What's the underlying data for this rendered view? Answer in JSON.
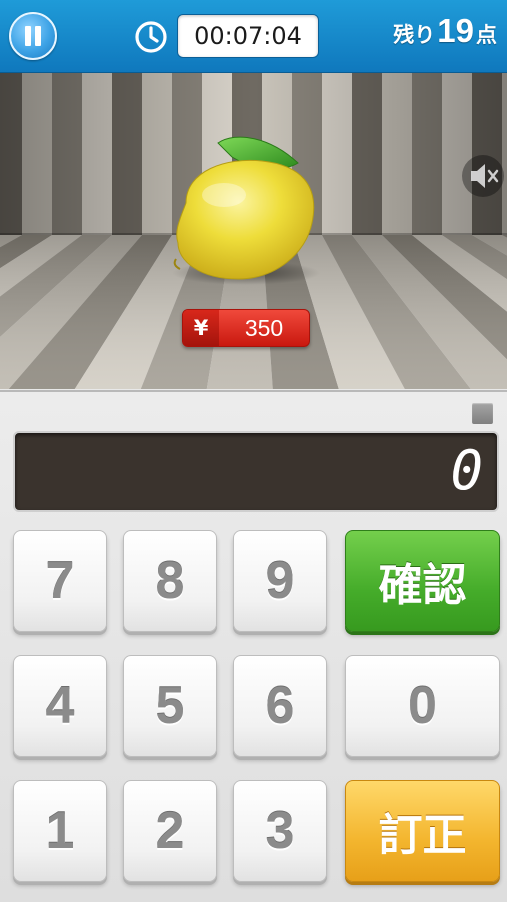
{
  "header": {
    "timer": "00:07:04",
    "remaining_prefix": "残り",
    "remaining_count": "19",
    "remaining_suffix": "点"
  },
  "stage": {
    "item": "lemon-image",
    "price_currency": "¥",
    "price_value": "350"
  },
  "calculator": {
    "display_value": "0",
    "keys": {
      "k7": "7",
      "k8": "8",
      "k9": "9",
      "k4": "4",
      "k5": "5",
      "k6": "6",
      "k1": "1",
      "k2": "2",
      "k3": "3",
      "k0": "0",
      "confirm": "確認",
      "correct": "訂正"
    }
  },
  "icons": [
    "pause-icon",
    "clock-icon",
    "mute-icon"
  ],
  "colors": {
    "topbar": "#1489cc",
    "confirm_button": "#45ac2a",
    "correct_button": "#f3b52e",
    "price_tag": "#d82a1e",
    "display_bg": "#3a332d"
  }
}
